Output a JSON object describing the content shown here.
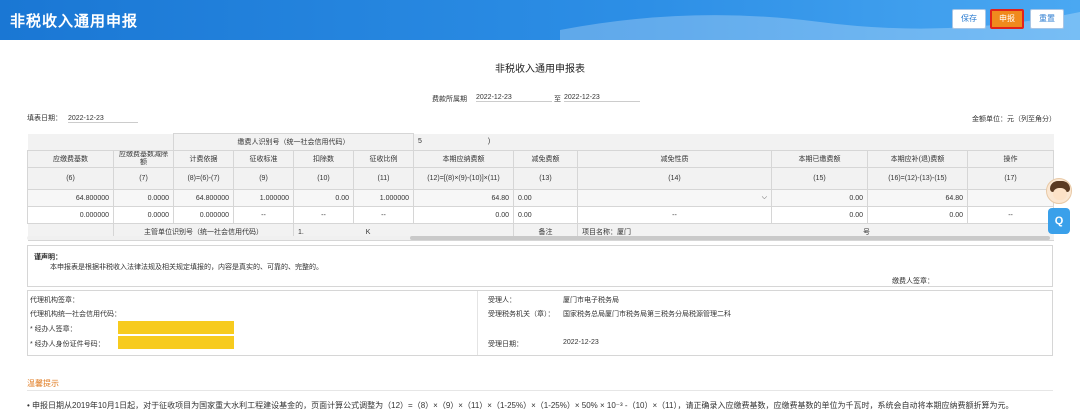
{
  "header": {
    "title": "非税收入通用申报",
    "buttons": {
      "save": "保存",
      "submit": "申报",
      "reset": "重置"
    }
  },
  "form": {
    "title": "非税收入通用申报表",
    "period_label": "费款所属期",
    "period_from": "2022-12-23",
    "period_to_label": "至",
    "period_to": "2022-12-23",
    "fill_date_label": "填表日期：",
    "fill_date": "2022-12-23",
    "unit_label": "金额单位：元（列至角分）",
    "payer_id_label": "缴费人识别号（统一社会信用代码）",
    "payer_id_value": "5",
    "payer_id_close": ")",
    "columns": [
      "应缴费基数",
      "应缴费基数减除额",
      "计费依据",
      "征收标准",
      "扣除数",
      "征收比例",
      "本期应纳费额",
      "减免费额",
      "减免性质",
      "本期已缴费额",
      "本期应补(退)费额",
      "操作"
    ],
    "col_codes": [
      "(6)",
      "(7)",
      "(8)=(6)-(7)",
      "(9)",
      "(10)",
      "(11)",
      "(12)=[(8)×(9)-(10)]×(11)",
      "(13)",
      "(14)",
      "(15)",
      "(16)=(12)-(13)-(15)",
      "(17)"
    ],
    "rows": [
      [
        "64.800000",
        "0.0000",
        "64.800000",
        "1.000000",
        "0.00",
        "1.000000",
        "64.80",
        "0.00",
        "",
        "0.00",
        "64.80",
        ""
      ],
      [
        "0.000000",
        "0.0000",
        "0.000000",
        "--",
        "--",
        "--",
        "0.00",
        "0.00",
        "--",
        "0.00",
        "0.00",
        "--"
      ]
    ],
    "supervisor_label": "主管单位识别号（统一社会信用代码）",
    "supervisor_value": "1.",
    "supervisor_value2": "K",
    "remark_label": "备注",
    "project_label": "项目名称：厦门",
    "project_suffix": "号",
    "chevron": "⌵"
  },
  "declaration": {
    "title": "谨声明：",
    "text": "本申报表是根据非税收入法律法规及相关规定填报的，内容是真实的、可靠的、完整的。",
    "sign_label": "缴费人签章："
  },
  "agent": {
    "agency_seal_label": "代理机构签章：",
    "agency_code_label": "代理机构统一社会信用代码：",
    "handler_seal_label": "* 经办人签章：",
    "handler_id_label": "* 经办人身份证件号码：",
    "receiver_label": "受理人：",
    "receiver_value": "厦门市电子税务局",
    "tax_office_label": "受理税务机关（章）：",
    "tax_office_value": "国家税务总局厦门市税务局第三税务分局税源管理二科",
    "accept_date_label": "受理日期：",
    "accept_date_value": "2022-12-23"
  },
  "notice": {
    "title": "温馨提示",
    "text": "• 申报日期从2019年10月1日起，对于征收项目为国家重大水利工程建设基金的，页面计算公式调整为（12）=（8）×（9）×（11）×（1-25%）×（1-25%）× 50% × 10⁻³ -（10）×（11），请正确录入应缴费基数，应缴费基数的单位为千瓦时，系统会自动将本期应纳费额折算为元。"
  },
  "helper": {
    "chat_label": "Q"
  },
  "colors": {
    "topbar": "#1a77d4",
    "submit_bg": "#f08a1d",
    "submit_border": "#e2231a",
    "notice_title": "#e07a1f",
    "required_fill": "#f7cb1e"
  }
}
